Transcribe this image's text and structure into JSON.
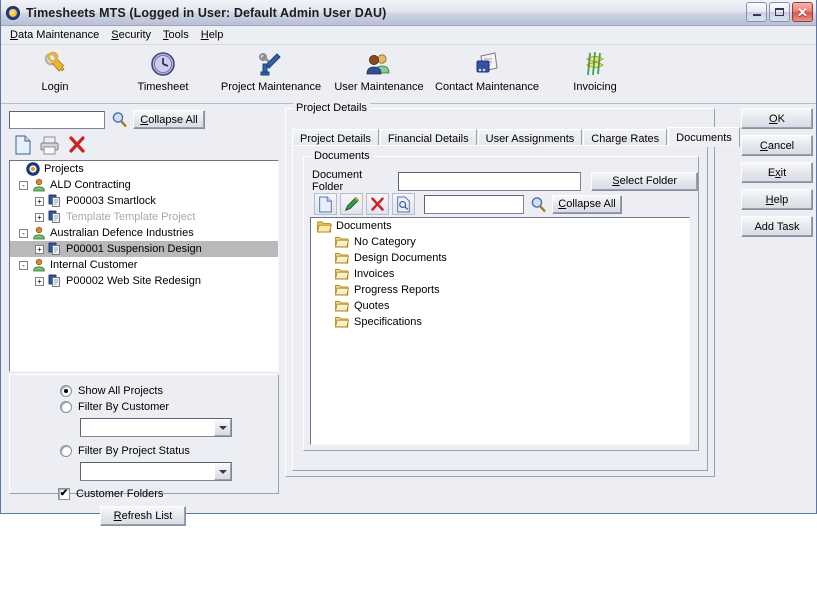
{
  "window": {
    "title": "Timesheets MTS (Logged in User: Default Admin User DAU)",
    "icon": "app-target-icon",
    "minimize_label": "Minimize",
    "maximize_label": "Maximize",
    "close_label": "Close"
  },
  "menubar": {
    "items": [
      {
        "label": "Data Maintenance",
        "accel": "D"
      },
      {
        "label": "Security",
        "accel": "S"
      },
      {
        "label": "Tools",
        "accel": "T"
      },
      {
        "label": "Help",
        "accel": "H"
      }
    ]
  },
  "toolbar": {
    "buttons": [
      {
        "label": "Login",
        "icon": "keys-icon"
      },
      {
        "label": "Timesheet",
        "icon": "clock-icon"
      },
      {
        "label": "Project Maintenance",
        "icon": "tools-icon"
      },
      {
        "label": "User Maintenance",
        "icon": "users-icon"
      },
      {
        "label": "Contact Maintenance",
        "icon": "contacts-icon"
      },
      {
        "label": "Invoicing",
        "icon": "money-icon"
      }
    ]
  },
  "left_panel": {
    "search_value": "",
    "search_icon": "magnifier-icon",
    "collapse_all_label": "Collapse All",
    "collapse_all_accel": "C",
    "tool_buttons": [
      {
        "name": "new-project-button",
        "icon": "new-document-icon"
      },
      {
        "name": "print-button",
        "icon": "printer-icon"
      },
      {
        "name": "delete-button",
        "icon": "red-x-icon"
      }
    ],
    "tree": [
      {
        "label": "Projects",
        "level": 0,
        "icon": "target-icon",
        "expander": "",
        "selected": false,
        "dim": false
      },
      {
        "label": "ALD Contracting",
        "level": 1,
        "icon": "customer-icon",
        "expander": "-",
        "selected": false,
        "dim": false
      },
      {
        "label": "P00003 Smartlock",
        "level": 2,
        "icon": "project-icon",
        "expander": "+",
        "selected": false,
        "dim": false
      },
      {
        "label": "Template Template Project",
        "level": 2,
        "icon": "project-icon",
        "expander": "+",
        "selected": false,
        "dim": true
      },
      {
        "label": "Australian Defence Industries",
        "level": 1,
        "icon": "customer-icon",
        "expander": "-",
        "selected": false,
        "dim": false
      },
      {
        "label": "P00001 Suspension Design",
        "level": 2,
        "icon": "project-icon",
        "expander": "+",
        "selected": true,
        "dim": false
      },
      {
        "label": "Internal Customer",
        "level": 1,
        "icon": "customer-icon",
        "expander": "-",
        "selected": false,
        "dim": false
      },
      {
        "label": "P00002 Web Site Redesign",
        "level": 2,
        "icon": "project-icon",
        "expander": "+",
        "selected": false,
        "dim": false
      }
    ],
    "filters": {
      "show_all_label": "Show All Projects",
      "show_all_selected": true,
      "filter_customer_label": "Filter By Customer",
      "filter_customer_selected": false,
      "customer_value": "",
      "filter_status_label": "Filter By Project Status",
      "filter_status_selected": false,
      "status_value": "",
      "customer_folders_label": "Customer Folders",
      "customer_folders_checked": true,
      "customer_folders_mark": "✔",
      "refresh_label": "Refresh List",
      "refresh_accel": "R"
    }
  },
  "project_details": {
    "group_label": "Project Details",
    "tabs": [
      {
        "label": "Project Details",
        "active": false
      },
      {
        "label": "Financial Details",
        "active": false
      },
      {
        "label": "User Assignments",
        "active": false
      },
      {
        "label": "Charge Rates",
        "active": false
      },
      {
        "label": "Documents",
        "active": true
      }
    ],
    "documents": {
      "group_label": "Documents",
      "folder_label": "Document Folder",
      "folder_value": "",
      "select_folder_label": "Select Folder",
      "select_folder_accel": "S",
      "tool_buttons": [
        {
          "name": "new-document-button",
          "icon": "new-document-icon"
        },
        {
          "name": "edit-document-button",
          "icon": "pencil-icon"
        },
        {
          "name": "delete-document-button",
          "icon": "red-x-icon"
        },
        {
          "name": "preview-document-button",
          "icon": "preview-icon"
        }
      ],
      "search_value": "",
      "search_icon": "magnifier-icon",
      "collapse_all_label": "Collapse All",
      "collapse_all_accel": "C",
      "tree": [
        {
          "label": "Documents",
          "level": 0,
          "icon": "open-folder-icon"
        },
        {
          "label": "No Category",
          "level": 1,
          "icon": "folder-icon"
        },
        {
          "label": "Design Documents",
          "level": 1,
          "icon": "folder-icon"
        },
        {
          "label": "Invoices",
          "level": 1,
          "icon": "folder-icon"
        },
        {
          "label": "Progress Reports",
          "level": 1,
          "icon": "folder-icon"
        },
        {
          "label": "Quotes",
          "level": 1,
          "icon": "folder-icon"
        },
        {
          "label": "Specifications",
          "level": 1,
          "icon": "folder-icon"
        }
      ]
    }
  },
  "action_buttons": [
    {
      "label": "OK",
      "accel": "O"
    },
    {
      "label": "Cancel",
      "accel": "C"
    },
    {
      "label": "Exit",
      "accel": "x"
    },
    {
      "label": "Help",
      "accel": "H"
    },
    {
      "label": "Add Task",
      "accel": ""
    }
  ],
  "colors": {
    "window_face": "#eceef3",
    "selection": "#b9b9b9",
    "title_text": "#1c1c20",
    "folder_yellow": "#f5d98a",
    "accent_blue": "#1b3e8c",
    "close_red": "#d6564a"
  }
}
